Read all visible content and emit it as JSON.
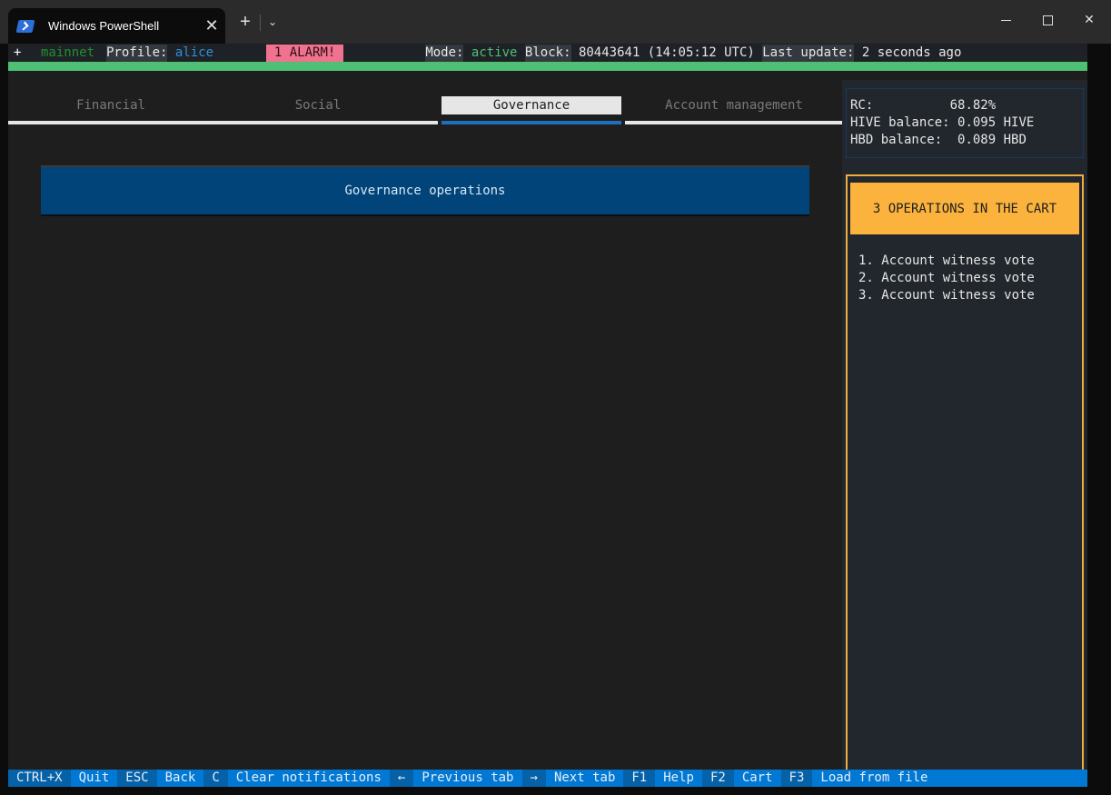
{
  "window": {
    "tab_title": "Windows PowerShell",
    "tab_icon": "powershell-icon",
    "new_tab_label": "+",
    "dropdown_glyph": "⌄",
    "close_glyph": "✕",
    "window_close_glyph": "✕"
  },
  "header": {
    "plus": "+",
    "network": "mainnet",
    "profile_label": "Profile:",
    "profile_value": "alice",
    "alarm": "1 ALARM!",
    "mode_label": "Mode:",
    "mode_value": "active",
    "block_label": "Block:",
    "block_value": "80443641 (14:05:12 UTC)",
    "last_update_label": "Last update:",
    "last_update_value": "2 seconds ago"
  },
  "tabs": [
    {
      "label": "Financial",
      "active": false
    },
    {
      "label": "Social",
      "active": false
    },
    {
      "label": "Governance",
      "active": true
    },
    {
      "label": "Account management",
      "active": false
    }
  ],
  "main": {
    "section_title": "Governance operations"
  },
  "balances": {
    "rc_label": "RC:",
    "rc_value": "68.82%",
    "hive_label": "HIVE balance:",
    "hive_value": "0.095 HIVE",
    "hbd_label": "HBD balance:",
    "hbd_value": "0.089 HBD"
  },
  "cart": {
    "title": "3 OPERATIONS IN THE CART",
    "items": [
      "1. Account witness vote",
      "2. Account witness vote",
      "3. Account witness vote"
    ]
  },
  "footer": {
    "bindings": [
      {
        "key": "CTRL+X",
        "desc": "Quit"
      },
      {
        "key": "ESC",
        "desc": "Back"
      },
      {
        "key": "C",
        "desc": "Clear notifications"
      },
      {
        "key": "←",
        "desc": "Previous tab"
      },
      {
        "key": "→",
        "desc": "Next tab"
      },
      {
        "key": "F1",
        "desc": "Help"
      },
      {
        "key": "F2",
        "desc": "Cart"
      },
      {
        "key": "F3",
        "desc": "Load from file"
      }
    ]
  },
  "colors": {
    "network": "#1f8f2f",
    "profile": "#2e8fd8",
    "alarm_bg": "#f0728e",
    "mode_active": "#4fbf74",
    "status_bar": "#4fbf74",
    "active_tab_underline": "#1f6fbf",
    "section_bg": "#00447a",
    "cart_accent": "#fbb33d",
    "footer_bg": "#0178d4",
    "footer_key_bg": "#0561a8"
  }
}
